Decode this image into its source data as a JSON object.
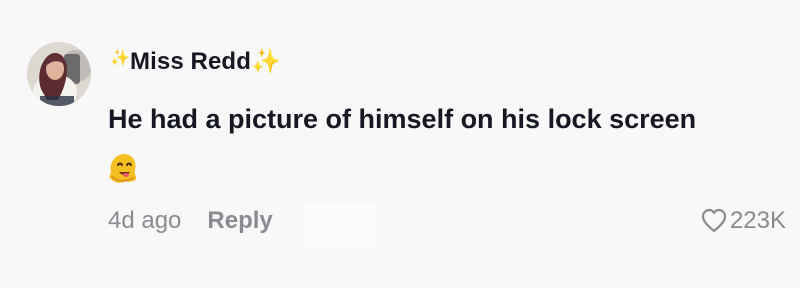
{
  "comment": {
    "username_prefix": "✨",
    "username": "Miss Redd",
    "username_suffix": "✨",
    "text": "He had a picture of himself on his lock screen",
    "emoji_icon": "melting-face-emoji",
    "time": "4d ago",
    "reply_label": "Reply",
    "like_count": "223K"
  },
  "icons": {
    "heart": "heart-outline-icon",
    "avatar": "profile-photo"
  },
  "colors": {
    "background": "#f8f8f8",
    "text_primary": "#161823",
    "text_secondary": "#8a8b91",
    "sparkle": "#f1c84b"
  }
}
